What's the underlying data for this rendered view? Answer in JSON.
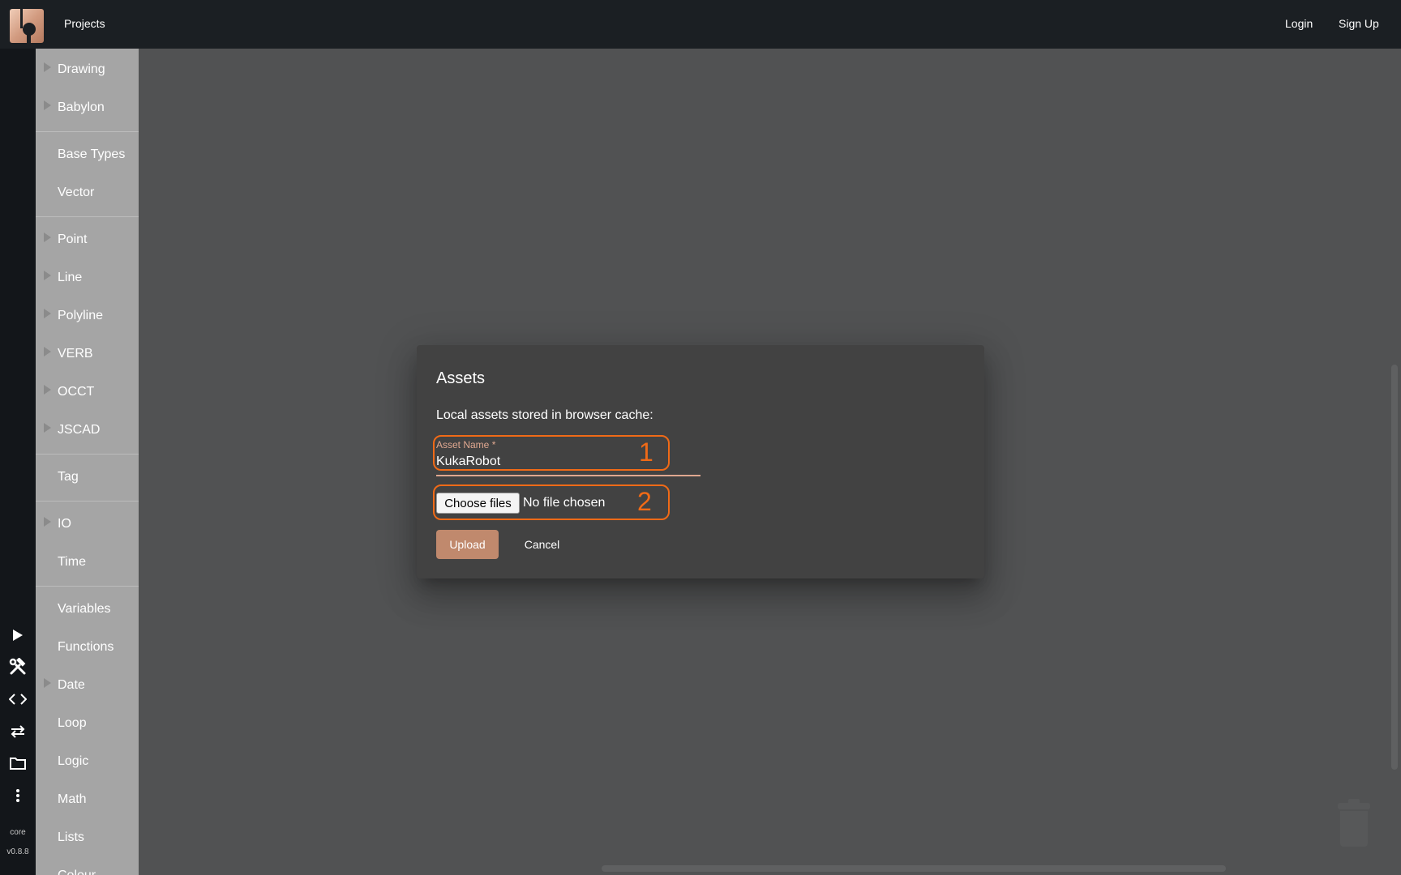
{
  "topbar": {
    "projects_label": "Projects",
    "login_label": "Login",
    "signup_label": "Sign Up"
  },
  "rail": {
    "icons": [
      "play-icon",
      "tools-icon",
      "code-icon",
      "swap-icon",
      "folder-icon",
      "more-vertical-icon"
    ],
    "core_label": "core",
    "version_label": "v0.8.8"
  },
  "categories": [
    {
      "label": "Drawing",
      "expandable": true
    },
    {
      "label": "Babylon",
      "expandable": true
    },
    {
      "label": "Base Types",
      "expandable": false
    },
    {
      "label": "Vector",
      "expandable": false
    },
    {
      "label": "Point",
      "expandable": true
    },
    {
      "label": "Line",
      "expandable": true
    },
    {
      "label": "Polyline",
      "expandable": true
    },
    {
      "label": "VERB",
      "expandable": true
    },
    {
      "label": "OCCT",
      "expandable": true
    },
    {
      "label": "JSCAD",
      "expandable": true
    },
    {
      "label": "Tag",
      "expandable": false
    },
    {
      "label": "IO",
      "expandable": true
    },
    {
      "label": "Time",
      "expandable": false
    },
    {
      "label": "Variables",
      "expandable": false
    },
    {
      "label": "Functions",
      "expandable": false
    },
    {
      "label": "Date",
      "expandable": true
    },
    {
      "label": "Loop",
      "expandable": false
    },
    {
      "label": "Logic",
      "expandable": false
    },
    {
      "label": "Math",
      "expandable": false
    },
    {
      "label": "Lists",
      "expandable": false
    },
    {
      "label": "Colour",
      "expandable": false
    }
  ],
  "dialog": {
    "title": "Assets",
    "description": "Local assets stored in browser cache:",
    "asset_name_label": "Asset Name *",
    "asset_name_value": "KukaRobot",
    "choose_files_label": "Choose files",
    "file_status": "No file chosen",
    "upload_label": "Upload",
    "cancel_label": "Cancel"
  },
  "annotations": {
    "one": "1",
    "two": "2"
  },
  "colors": {
    "topbar_bg": "#1b1f23",
    "accent": "#c0896d",
    "annotation": "#f06a17"
  }
}
